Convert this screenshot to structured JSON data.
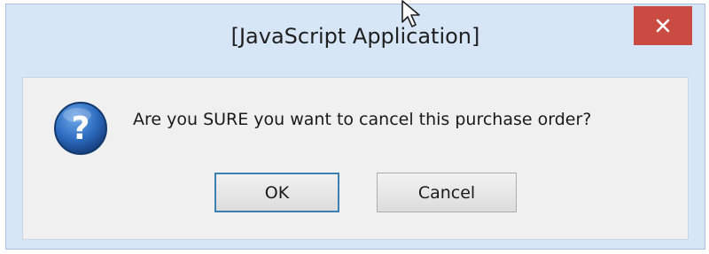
{
  "dialog": {
    "title": "[JavaScript Application]",
    "message": "Are you SURE you want to cancel this purchase order?",
    "ok_label": "OK",
    "cancel_label": "Cancel",
    "close_glyph": "×"
  },
  "icons": {
    "dialog_icon": "question-icon",
    "close_icon": "close-icon",
    "cursor": "mouse-pointer-icon"
  },
  "colors": {
    "frame": "#d7e6f6",
    "close_button": "#c94b42",
    "client_area": "#f0f0f0",
    "default_button_border": "#3c7fb1",
    "question_icon": "#2c6cc0"
  }
}
